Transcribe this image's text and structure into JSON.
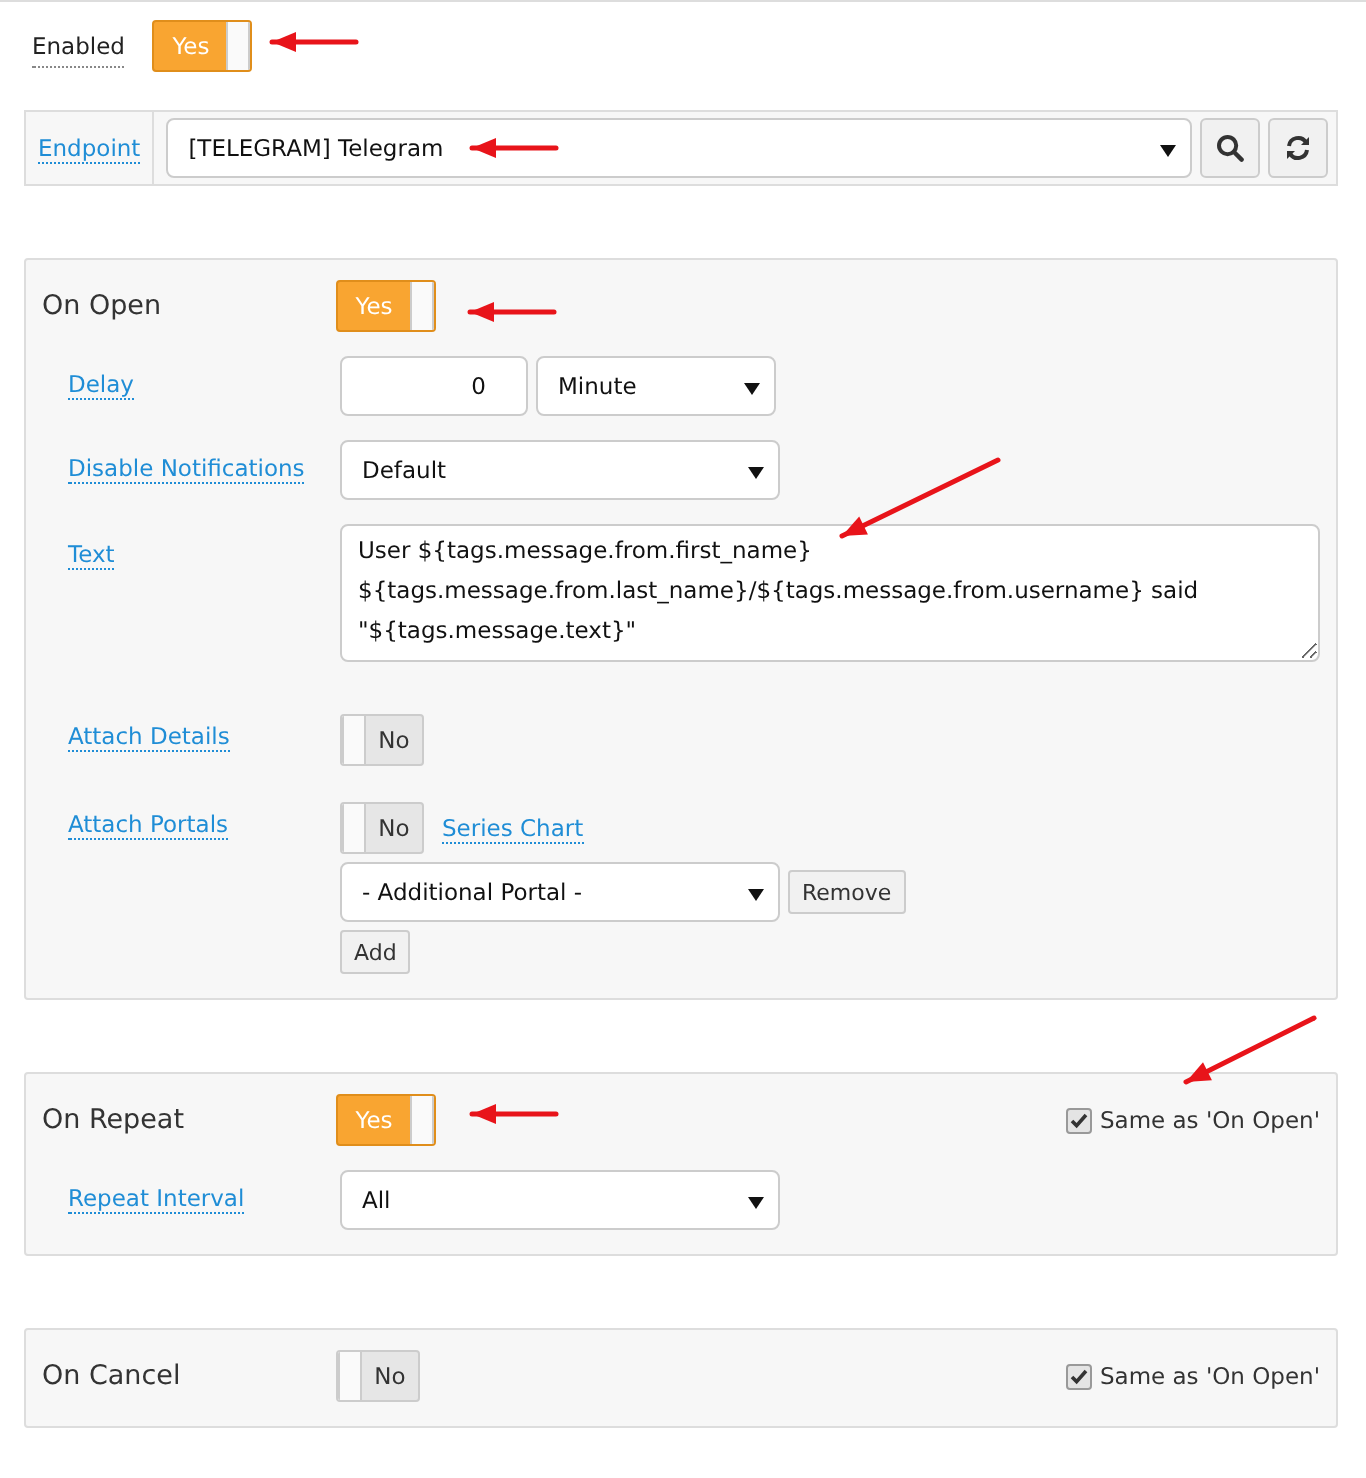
{
  "enabled": {
    "label": "Enabled",
    "toggle": {
      "on": true,
      "label": "Yes"
    }
  },
  "endpoint": {
    "label": "Endpoint",
    "value": "[TELEGRAM] Telegram"
  },
  "sections": [
    {
      "title": "On Open",
      "toggle": {
        "on": true,
        "label": "Yes"
      },
      "fields": [
        {
          "kind": "number_unit",
          "label": "Delay",
          "value": "0",
          "unit": "Minute"
        },
        {
          "kind": "select",
          "label": "Disable Notifications",
          "value": "Default"
        },
        {
          "kind": "textarea",
          "label": "Text",
          "value": "User ${tags.message.from.first_name} ${tags.message.from.last_name}/${tags.message.from.username} said \"${tags.message.text}\""
        },
        {
          "kind": "toggle",
          "label": "Attach Details",
          "toggle": {
            "on": false,
            "label": "No"
          }
        },
        {
          "kind": "portals",
          "label": "Attach Portals",
          "toggle": {
            "on": false,
            "label": "No"
          },
          "link": "Series Chart",
          "select": "- Additional Portal -",
          "remove": "Remove",
          "add": "Add"
        }
      ]
    },
    {
      "title": "On Repeat",
      "toggle": {
        "on": true,
        "label": "Yes"
      },
      "same_as": {
        "checked": true,
        "label": "Same as 'On Open'"
      },
      "fields": [
        {
          "kind": "select",
          "label": "Repeat Interval",
          "value": "All"
        }
      ]
    },
    {
      "title": "On Cancel",
      "toggle": {
        "on": false,
        "label": "No"
      },
      "same_as": {
        "checked": true,
        "label": "Same as 'On Open'"
      }
    }
  ]
}
